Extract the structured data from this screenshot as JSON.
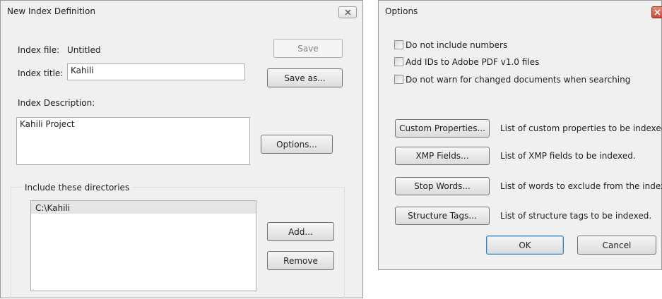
{
  "index_dialog": {
    "title": "New Index Definition",
    "index_file_label": "Index file:",
    "index_file_value": "Untitled",
    "index_title_label": "Index title:",
    "index_title_value": "Kahili",
    "save_label": "Save",
    "save_as_label": "Save as...",
    "description_label": "Index Description:",
    "description_value": "Kahili Project",
    "options_label": "Options...",
    "directories_group_label": "Include these directories",
    "directories": [
      "C:\\Kahili"
    ],
    "add_label": "Add...",
    "remove_label": "Remove",
    "close_icon": "close-icon"
  },
  "options_dialog": {
    "title": "Options",
    "checkboxes": [
      {
        "label": "Do not include numbers",
        "checked": false
      },
      {
        "label": "Add IDs to Adobe PDF v1.0 files",
        "checked": false
      },
      {
        "label": "Do not warn for changed documents when searching",
        "checked": false
      }
    ],
    "buttons": [
      {
        "label": "Custom Properties...",
        "description": "List of custom properties to be indexed."
      },
      {
        "label": "XMP Fields...",
        "description": "List of XMP fields to be indexed."
      },
      {
        "label": "Stop Words...",
        "description": "List of words to exclude from the index."
      },
      {
        "label": "Structure Tags...",
        "description": "List of structure tags to be indexed."
      }
    ],
    "ok_label": "OK",
    "cancel_label": "Cancel",
    "close_icon": "close-icon"
  },
  "colors": {
    "dialog_bg": "#f0f0f0",
    "close_button_red": "#c74a3a",
    "selected_row": "#e5e5e5"
  }
}
